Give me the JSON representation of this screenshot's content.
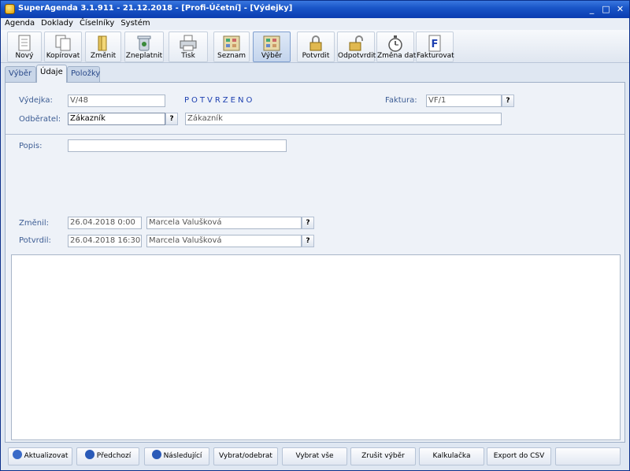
{
  "window": {
    "title": "SuperAgenda 3.1.911 - 21.12.2018 - [Profi-Účetní] - [Výdejky]"
  },
  "menu": [
    "Agenda",
    "Doklady",
    "Číselníky",
    "Systém"
  ],
  "toolbar": {
    "new": "Nový",
    "copy": "Kopírovat",
    "edit": "Změnit",
    "cancel": "Zneplatnit",
    "print": "Tisk",
    "list": "Seznam",
    "select": "Výběr",
    "confirm": "Potvrdit",
    "unconfirm": "Odpotvrdit",
    "change_date": "Změna data",
    "invoice": "Fakturovat"
  },
  "tabs": [
    "Výběr",
    "Údaje",
    "Položky"
  ],
  "form": {
    "vydejka_label": "Výdejka:",
    "vydejka_value": "V/48",
    "status": "POTVRZENO",
    "faktura_label": "Faktura:",
    "faktura_value": "VF/1",
    "odberatel_label": "Odběratel:",
    "odberatel_value": "Zákazník",
    "odberatel_name": "Zákazník",
    "popis_label": "Popis:",
    "popis_value": "",
    "zmenil_label": "Změnil:",
    "zmenil_date": "26.04.2018 0:00",
    "zmenil_user": "Marcela Valušková",
    "potvrdil_label": "Potvrdil:",
    "potvrdil_date": "26.04.2018 16:30",
    "potvrdil_user": "Marcela Valušková",
    "q": "?"
  },
  "bottom": {
    "refresh": "Aktualizovat",
    "prev": "Předchozí",
    "next": "Následující",
    "select_toggle": "Vybrat/odebrat",
    "select_all": "Vybrat vše",
    "cancel_select": "Zrušit výběr",
    "calc": "Kalkulačka",
    "export": "Export do CSV"
  },
  "window_controls": {
    "minimize": "_",
    "maximize": "□",
    "close": "✕"
  },
  "colors": {
    "status": "#1c3fb0",
    "titlebar": "#1a56c8"
  }
}
